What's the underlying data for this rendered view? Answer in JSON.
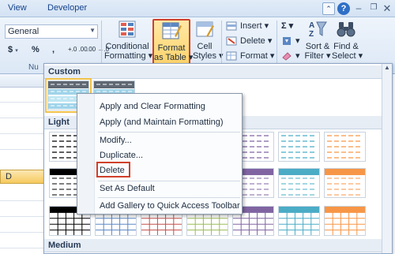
{
  "tabs": {
    "view": "View",
    "developer": "Developer"
  },
  "number_group": {
    "format_value": "General",
    "currency": "$",
    "currency_arrow": "▾",
    "percent": "%",
    "comma": ",",
    "inc_decimal": "+.0  .00",
    "dec_decimal": ".00  →.0",
    "group_label": "Nu"
  },
  "styles_group": {
    "conditional": "Conditional\nFormatting ▾",
    "format_table": "Format\nas Table ▾",
    "cell_styles": "Cell\nStyles ▾"
  },
  "cells_group": {
    "insert": "Insert ▾",
    "delete": "Delete ▾",
    "format": "Format ▾"
  },
  "editing_group": {
    "sigma": "Σ ▾",
    "fill": "▾",
    "clear": "▾",
    "sort": "Sort &\nFilter ▾",
    "find": "Find &\nSelect ▾"
  },
  "grid": {
    "column_header": "D"
  },
  "gallery": {
    "custom": "Custom",
    "light": "Light",
    "medium": "Medium"
  },
  "context_menu": {
    "apply_clear": "Apply and Clear Formatting",
    "apply_maintain": "Apply (and Maintain Formatting)",
    "modify": "Modify...",
    "duplicate": "Duplicate...",
    "delete": "Delete",
    "set_default": "Set As Default",
    "add_gallery": "Add Gallery to Quick Access Toolbar"
  },
  "colors": {
    "highlight_red": "#d0402a",
    "swatch_palette": [
      "#000000",
      "#5b87c4",
      "#c0504d",
      "#9bbb59",
      "#8064a2",
      "#4bacc6",
      "#f79646"
    ]
  }
}
